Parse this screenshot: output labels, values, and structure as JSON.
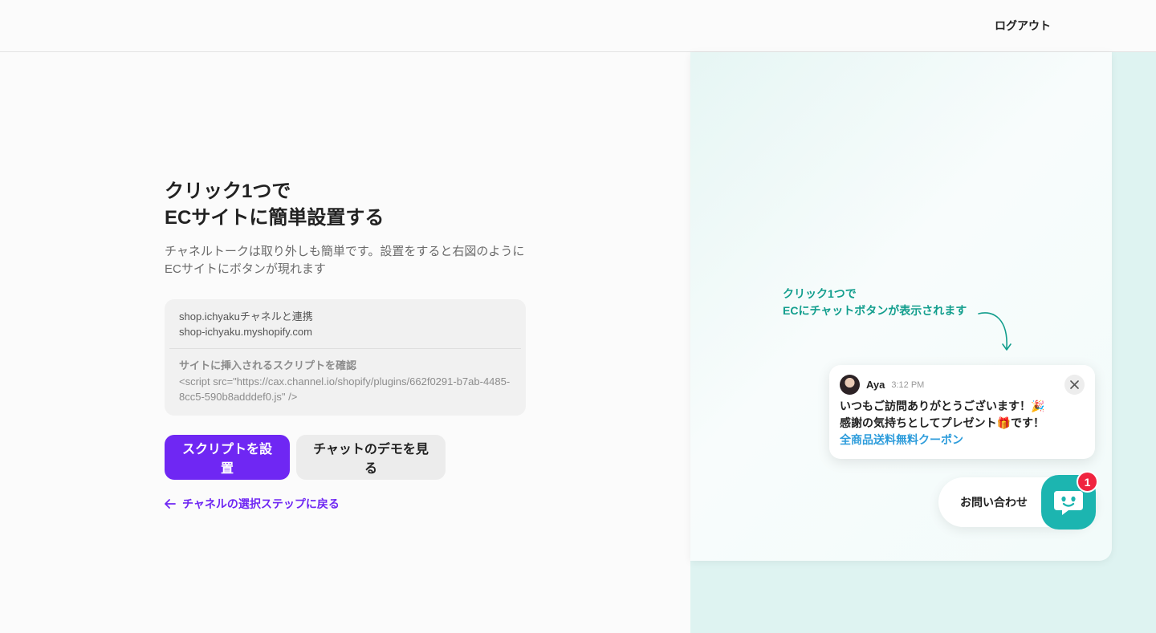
{
  "header": {
    "logout_label": "ログアウト"
  },
  "main": {
    "title_line1": "クリック1つで",
    "title_line2": "ECサイトに簡単設置する",
    "description": "チャネルトークは取り外しも簡単です。設置をすると右図のようにECサイトにボタンが現れます",
    "info": {
      "shop_link_label": "shop.ichyakuチャネルと連携",
      "shop_domain": "shop-ichyaku.myshopify.com",
      "script_heading": "サイトに挿入されるスクリプトを確認",
      "script_code": "<script src=\"https://cax.channel.io/shopify/plugins/662f0291-b7ab-4485-8cc5-590b8adddef0.js\" />"
    },
    "install_button_label": "スクリプトを設置",
    "demo_button_label": "チャットのデモを見る",
    "back_link_label": "チャネルの選択ステップに戻る"
  },
  "preview": {
    "annotation_line1": "クリック1つで",
    "annotation_line2": "ECにチャットボタンが表示されます",
    "popup": {
      "sender": "Aya",
      "time": "3:12 PM",
      "message_line1": "いつもご訪問ありがとうございます！🎉",
      "message_line2": "感謝の気持ちとしてプレゼント🎁です！",
      "coupon_link": "全商品送料無料クーポン"
    },
    "chat_button_label": "お問い合わせ",
    "badge_count": "1"
  },
  "colors": {
    "primary": "#6f27f3",
    "accent_teal": "#129e8d",
    "chat_icon": "#1cb5b0",
    "badge": "#f0243f",
    "link_blue": "#2d9cdb"
  },
  "icons": [
    "arrow-left-icon",
    "curved-arrow-icon",
    "close-icon",
    "chat-face-icon",
    "user-avatar"
  ]
}
